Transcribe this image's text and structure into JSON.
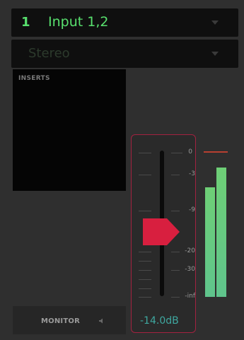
{
  "channel": {
    "number": "1",
    "input_name": "Input 1,2",
    "mode": "Stereo"
  },
  "inserts": {
    "label": "INSERTS"
  },
  "monitor": {
    "label": "MONITOR",
    "icon": "speaker-icon"
  },
  "fader": {
    "value_label": "-14.0dB",
    "value_db": -14.0,
    "scale": [
      "0",
      "-3",
      "-9",
      "-20",
      "-30",
      "-inf"
    ]
  },
  "meter": {
    "left_level": 0.72,
    "right_level": 0.85,
    "peak_level": 0.96
  },
  "colors": {
    "accent_green": "#58e06e",
    "fader_red": "#d81f3f",
    "meter_green": "#6ecf76",
    "readout_teal": "#3fa8a0"
  }
}
